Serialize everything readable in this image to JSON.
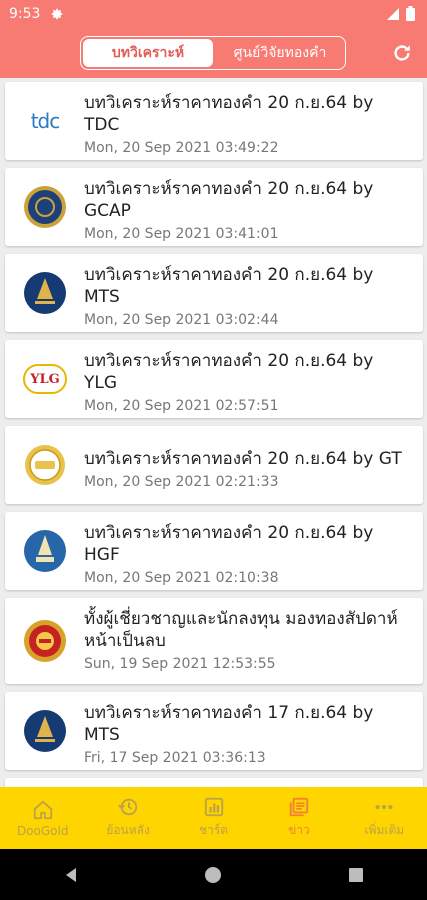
{
  "status_bar": {
    "time": "9:53"
  },
  "header": {
    "tabs": [
      {
        "label": "บทวิเคราะห์",
        "active": true
      },
      {
        "label": "ศูนย์วิจัยทองคำ",
        "active": false
      }
    ]
  },
  "articles": [
    {
      "title": "บทวิเคราะห์ราคาทองคำ 20 ก.ย.64 by TDC",
      "date": "Mon, 20 Sep 2021 03:49:22",
      "logo": "tdc-logo"
    },
    {
      "title": "บทวิเคราะห์ราคาทองคำ 20 ก.ย.64 by GCAP",
      "date": "Mon, 20 Sep 2021 03:41:01",
      "logo": "gcap-logo"
    },
    {
      "title": "บทวิเคราะห์ราคาทองคำ 20 ก.ย.64 by MTS",
      "date": "Mon, 20 Sep 2021 03:02:44",
      "logo": "mts-logo"
    },
    {
      "title": "บทวิเคราะห์ราคาทองคำ 20 ก.ย.64 by YLG",
      "date": "Mon, 20 Sep 2021 02:57:51",
      "logo": "ylg-logo"
    },
    {
      "title": "บทวิเคราะห์ราคาทองคำ 20 ก.ย.64 by GT",
      "date": "Mon, 20 Sep 2021 02:21:33",
      "logo": "gt-logo"
    },
    {
      "title": "บทวิเคราะห์ราคาทองคำ 20 ก.ย.64 by HGF",
      "date": "Mon, 20 Sep 2021 02:10:38",
      "logo": "hgf-logo"
    },
    {
      "title": "ทั้งผู้เชี่ยวชาญและนักลงทุน มองทองสัปดาห์หน้าเป็นลบ",
      "date": "Sun, 19 Sep 2021 12:53:55",
      "logo": "news-logo"
    },
    {
      "title": "บทวิเคราะห์ราคาทองคำ 17 ก.ย.64 by MTS",
      "date": "Fri, 17 Sep 2021 03:36:13",
      "logo": "mts-logo"
    }
  ],
  "logo_text": {
    "tdc": "tdc",
    "ylg": "YLG"
  },
  "bottom_nav": [
    {
      "label": "DooGold",
      "icon": "home-icon",
      "active": false
    },
    {
      "label": "ย้อนหลัง",
      "icon": "history-icon",
      "active": false
    },
    {
      "label": "ชาร์ต",
      "icon": "chart-icon",
      "active": false
    },
    {
      "label": "ข่าว",
      "icon": "news-icon",
      "active": true
    },
    {
      "label": "เพิ่มเติม",
      "icon": "more-icon",
      "active": false
    }
  ],
  "colors": {
    "header": "#f77a73",
    "nav_bg": "#ffd500",
    "nav_active": "#f08036"
  }
}
